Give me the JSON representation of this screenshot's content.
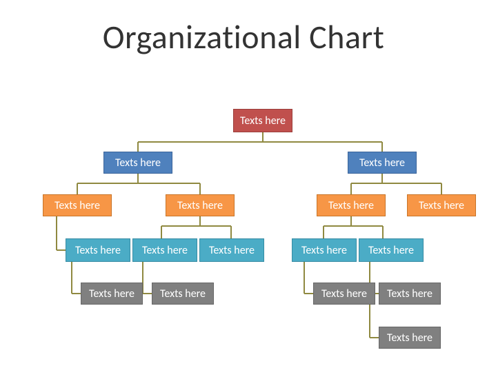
{
  "title": "Organizational Chart",
  "nodes": {
    "root": "Texts here",
    "l2a": "Texts here",
    "l2b": "Texts here",
    "l3a": "Texts here",
    "l3b": "Texts here",
    "l3c": "Texts here",
    "l3d": "Texts here",
    "l4a": "Texts here",
    "l4b": "Texts here",
    "l4c": "Texts here",
    "l4d": "Texts here",
    "l4e": "Texts here",
    "l5a": "Texts here",
    "l5b": "Texts here",
    "l5c": "Texts here",
    "l5d": "Texts here",
    "l5e": "Texts here"
  },
  "colors": {
    "red": "#c0504d",
    "blue": "#4f81bd",
    "orange": "#f79646",
    "teal": "#4bacc6",
    "gray": "#808080",
    "connector": "#8f8940"
  },
  "chart_data": {
    "type": "org-chart",
    "title": "Organizational Chart",
    "root": {
      "label": "Texts here",
      "color": "red",
      "children": [
        {
          "label": "Texts here",
          "color": "blue",
          "children": [
            {
              "label": "Texts here",
              "color": "orange",
              "children": [
                {
                  "label": "Texts here",
                  "color": "teal",
                  "children": [
                    {
                      "label": "Texts here",
                      "color": "gray"
                    }
                  ]
                }
              ]
            },
            {
              "label": "Texts here",
              "color": "orange",
              "children": [
                {
                  "label": "Texts here",
                  "color": "teal",
                  "children": [
                    {
                      "label": "Texts here",
                      "color": "gray"
                    }
                  ]
                },
                {
                  "label": "Texts here",
                  "color": "teal"
                }
              ]
            }
          ]
        },
        {
          "label": "Texts here",
          "color": "blue",
          "children": [
            {
              "label": "Texts here",
              "color": "orange",
              "children": [
                {
                  "label": "Texts here",
                  "color": "teal",
                  "children": [
                    {
                      "label": "Texts here",
                      "color": "gray"
                    }
                  ]
                },
                {
                  "label": "Texts here",
                  "color": "teal",
                  "children": [
                    {
                      "label": "Texts here",
                      "color": "gray"
                    },
                    {
                      "label": "Texts here",
                      "color": "gray"
                    }
                  ]
                }
              ]
            },
            {
              "label": "Texts here",
              "color": "orange"
            }
          ]
        }
      ]
    }
  }
}
